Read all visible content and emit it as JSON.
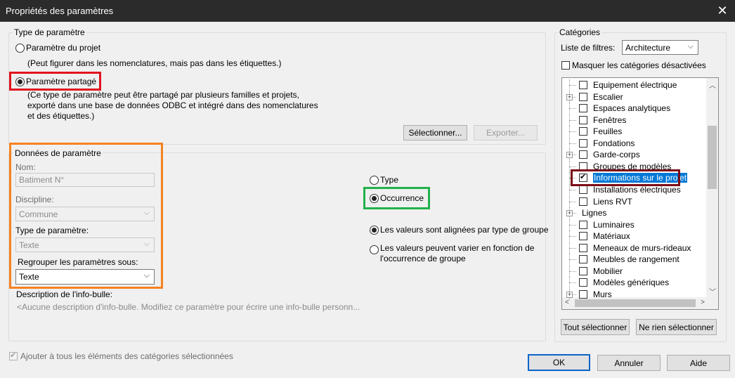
{
  "window": {
    "title": "Propriétés des paramètres",
    "close": "✕"
  },
  "param_type": {
    "legend": "Type de paramètre",
    "project_label": "Paramètre du projet",
    "project_note": "(Peut figurer dans les nomenclatures, mais pas dans les étiquettes.)",
    "shared_label": "Paramètre partagé",
    "shared_note": [
      "(Ce type de paramètre peut être partagé par plusieurs familles et projets,",
      "exporté dans une base de données ODBC et intégré dans des nomenclatures",
      "et des étiquettes.)"
    ],
    "select_button": "Sélectionner...",
    "export_button": "Exporter..."
  },
  "param_data": {
    "legend": "Données de paramètre",
    "name_label": "Nom:",
    "name_value": "Batiment N°",
    "discipline_label": "Discipline:",
    "discipline_value": "Commune",
    "type_label": "Type de paramètre:",
    "type_value": "Texte",
    "group_label": "Regrouper les paramètres sous:",
    "group_value": "Texte",
    "tooltip_label": "Description de l'info-bulle:",
    "tooltip_value": "<Aucune description d'info-bulle. Modifiez ce paramètre pour écrire une info-bulle personn...",
    "type_radio": "Type",
    "occurrence_radio": "Occurrence",
    "aligned_radio": "Les valeurs sont alignées par type de groupe",
    "vary_radio": [
      "Les valeurs peuvent varier en fonction de",
      "l'occurrence de groupe"
    ]
  },
  "categories": {
    "legend": "Catégories",
    "filter_label": "Liste de filtres:",
    "filter_value": "Architecture",
    "hide_disabled": "Masquer les catégories désactivées",
    "items": [
      {
        "label": "Equipement électrique",
        "expand": false,
        "checked": false
      },
      {
        "label": "Escalier",
        "expand": true,
        "checked": false
      },
      {
        "label": "Espaces analytiques",
        "expand": false,
        "checked": false
      },
      {
        "label": "Fenêtres",
        "expand": false,
        "checked": false
      },
      {
        "label": "Feuilles",
        "expand": false,
        "checked": false
      },
      {
        "label": "Fondations",
        "expand": false,
        "checked": false
      },
      {
        "label": "Garde-corps",
        "expand": true,
        "checked": false
      },
      {
        "label": "Groupes de modèles",
        "expand": false,
        "checked": false
      },
      {
        "label": "Informations sur le projet",
        "expand": false,
        "checked": true,
        "selected": true
      },
      {
        "label": "Installations électriques",
        "expand": false,
        "checked": false
      },
      {
        "label": "Liens RVT",
        "expand": false,
        "checked": false
      },
      {
        "label": "Lignes",
        "expand": true,
        "checked": false,
        "nobox": true
      },
      {
        "label": "Luminaires",
        "expand": false,
        "checked": false
      },
      {
        "label": "Matériaux",
        "expand": false,
        "checked": false
      },
      {
        "label": "Meneaux de murs-rideaux",
        "expand": false,
        "checked": false
      },
      {
        "label": "Meubles de rangement",
        "expand": false,
        "checked": false
      },
      {
        "label": "Mobilier",
        "expand": false,
        "checked": false
      },
      {
        "label": "Modèles génériques",
        "expand": false,
        "checked": false
      },
      {
        "label": "Murs",
        "expand": true,
        "checked": false
      }
    ],
    "select_all": "Tout sélectionner",
    "select_none": "Ne rien sélectionner"
  },
  "footer": {
    "add_all": "Ajouter à tous les éléments des catégories sélectionnées",
    "ok": "OK",
    "cancel": "Annuler",
    "help": "Aide"
  },
  "colors": {
    "title_bar": "#2b2b2b",
    "highlight_red": "#e0141e",
    "highlight_orange": "#f5821f",
    "highlight_green": "#22b14c",
    "highlight_maroon": "#7b0a14",
    "selection": "#0078d7"
  }
}
